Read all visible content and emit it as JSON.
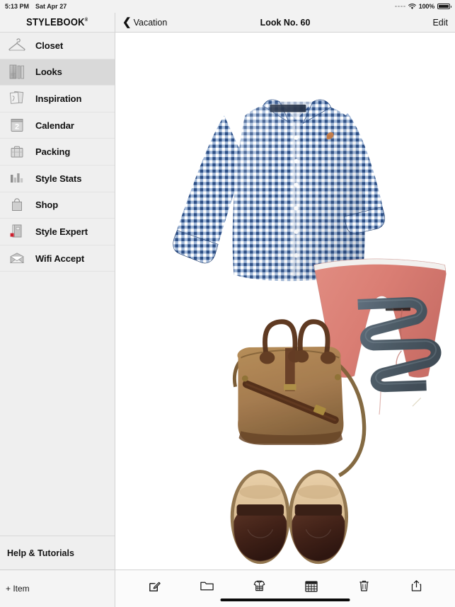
{
  "status_bar": {
    "time": "5:13 PM",
    "date": "Sat Apr 27",
    "battery_percent": "100%",
    "wifi_icon": "wifi-icon",
    "battery_icon": "battery-full-icon",
    "signal_icon": "signal-dots-icon"
  },
  "sidebar": {
    "brand": "STYLEBOOK",
    "brand_mark": "®",
    "items": [
      {
        "label": "Closet",
        "icon": "hanger-icon",
        "active": false
      },
      {
        "label": "Looks",
        "icon": "garments-icon",
        "active": true
      },
      {
        "label": "Inspiration",
        "icon": "photos-icon",
        "active": false
      },
      {
        "label": "Calendar",
        "icon": "calendar-icon",
        "active": false,
        "badge": "2"
      },
      {
        "label": "Packing",
        "icon": "suitcase-icon",
        "active": false
      },
      {
        "label": "Style Stats",
        "icon": "bar-chart-icon",
        "active": false
      },
      {
        "label": "Shop",
        "icon": "shopping-bag-icon",
        "active": false
      },
      {
        "label": "Style Expert",
        "icon": "book-icon",
        "active": false
      },
      {
        "label": "Wifi Accept",
        "icon": "envelope-icon",
        "active": false
      }
    ],
    "help_label": "Help & Tutorials",
    "add_item_label": "+ Item"
  },
  "navbar": {
    "back_label": "Vacation",
    "back_icon": "chevron-left-icon",
    "title": "Look No. 60",
    "edit_label": "Edit"
  },
  "look": {
    "items": [
      {
        "name": "gingham-shirt",
        "type": "Shirt",
        "color": "#5b7fb5",
        "description": "Blue gingham long-sleeve button-down shirt"
      },
      {
        "name": "chino-shorts",
        "type": "Shorts",
        "color": "#dd7f76",
        "description": "Salmon red chino shorts"
      },
      {
        "name": "woven-belt",
        "type": "Belt",
        "color": "#5b6a78",
        "description": "Grey-blue woven belt coiled"
      },
      {
        "name": "canvas-bag",
        "type": "Bag",
        "color": "#b08455",
        "description": "Tan canvas briefcase with brown leather trim"
      },
      {
        "name": "leather-loafers",
        "type": "Shoes",
        "color": "#4a2a1e",
        "description": "Dark brown leather penny loafers"
      }
    ]
  },
  "toolbar": {
    "buttons": [
      {
        "label": "Edit",
        "icon": "compose-icon"
      },
      {
        "label": "Folder",
        "icon": "folder-icon"
      },
      {
        "label": "Garment",
        "icon": "shirt-icon"
      },
      {
        "label": "Calendar",
        "icon": "grid-calendar-icon"
      },
      {
        "label": "Delete",
        "icon": "trash-icon"
      },
      {
        "label": "Share",
        "icon": "share-icon"
      }
    ]
  },
  "colors": {
    "sidebar_bg": "#efefef",
    "active_item_bg": "#d9d9d9",
    "bar_bg": "#f2f2f2",
    "canvas_bg": "#ffffff",
    "badge_red": "#cc1f2e"
  }
}
